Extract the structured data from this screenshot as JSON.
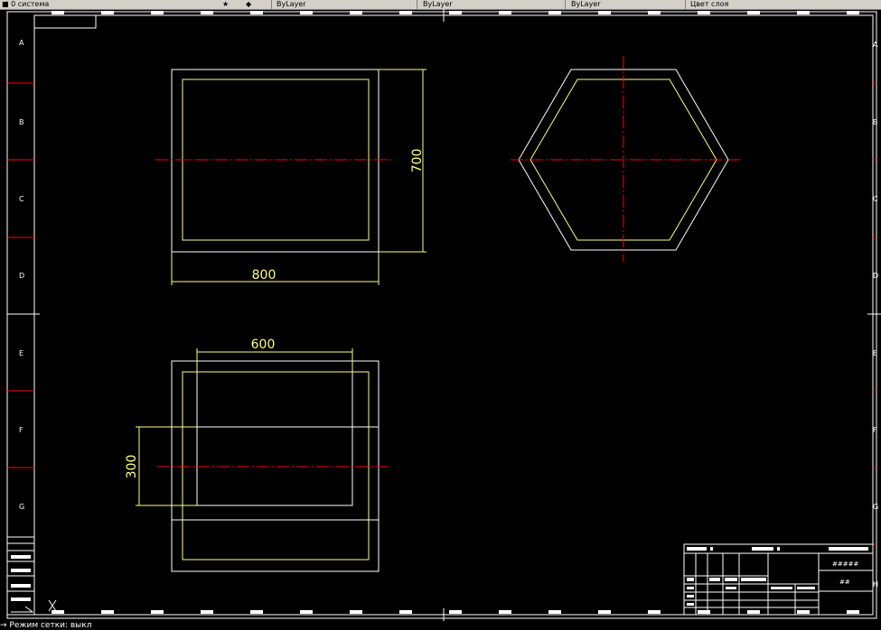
{
  "toolbar": {
    "layer_label": "0 система",
    "tab1": "ByLayer",
    "tab2": "ByLayer",
    "tab3": "ByLayer",
    "tab4": "Цвет слоя"
  },
  "drawing": {
    "row_labels": [
      "A",
      "B",
      "C",
      "D",
      "E",
      "F",
      "G"
    ],
    "right_labels": [
      "A",
      "B",
      "C",
      "D",
      "E",
      "F",
      "G",
      "H"
    ],
    "dimensions": {
      "width_top": "800",
      "height_top": "700",
      "width_bottom": "600",
      "height_bottom": "300"
    },
    "colors": {
      "outline": "#ffffff",
      "inner": "#ffff7f",
      "centerline": "#ff0000",
      "dimension": "#ffff7f",
      "border": "#ffffff",
      "grid_marks": "#ff0000"
    }
  },
  "title_block": {
    "label_1": "#####",
    "label_2": "##"
  },
  "command_line": {
    "text": "→ Режим сетки: выкл"
  }
}
